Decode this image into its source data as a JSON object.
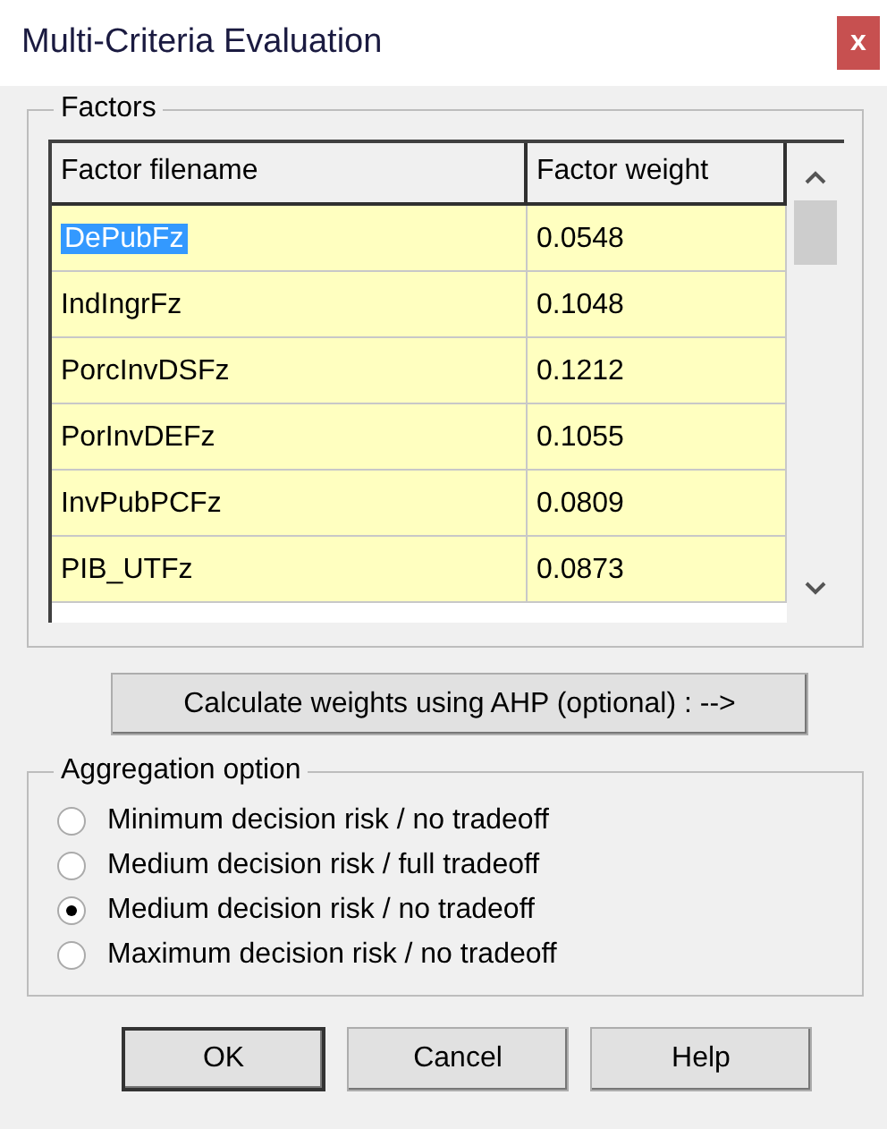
{
  "window": {
    "title": "Multi-Criteria Evaluation",
    "close": "x"
  },
  "factors": {
    "title": "Factors",
    "columns": [
      "Factor filename",
      "Factor weight"
    ],
    "rows": [
      {
        "filename": "DePubFz",
        "weight": "0.0548",
        "selected": true
      },
      {
        "filename": "IndIngrFz",
        "weight": "0.1048",
        "selected": false
      },
      {
        "filename": "PorcInvDSFz",
        "weight": "0.1212",
        "selected": false
      },
      {
        "filename": "PorInvDEFz",
        "weight": "0.1055",
        "selected": false
      },
      {
        "filename": "InvPubPCFz",
        "weight": "0.0809",
        "selected": false
      },
      {
        "filename": "PIB_UTFz",
        "weight": "0.0873",
        "selected": false
      }
    ]
  },
  "ahp_button": "Calculate weights using AHP (optional) :  -->",
  "aggregation": {
    "title": "Aggregation option",
    "options": [
      {
        "label": "Minimum decision risk / no tradeoff",
        "selected": false
      },
      {
        "label": "Medium decision risk / full tradeoff",
        "selected": false
      },
      {
        "label": "Medium decision risk / no tradeoff",
        "selected": true
      },
      {
        "label": "Maximum decision risk / no tradeoff",
        "selected": false
      }
    ]
  },
  "buttons": [
    {
      "label": "OK",
      "default": true
    },
    {
      "label": "Cancel",
      "default": false
    },
    {
      "label": "Help",
      "default": false
    }
  ]
}
